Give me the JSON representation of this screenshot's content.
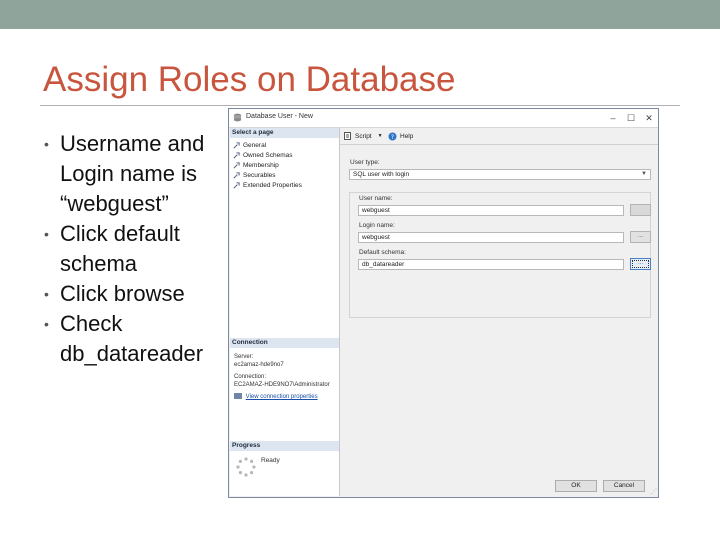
{
  "slide": {
    "title": "Assign Roles on Database",
    "bullets": [
      "Username and Login name is “webguest”",
      "Click default schema",
      "Click browse",
      "Check db_datareader"
    ],
    "accent_color": "#c8553d",
    "topbar_color": "#8fa49a"
  },
  "dialog": {
    "title": "Database User - New",
    "left_pane": {
      "select_page_header": "Select a page",
      "pages": [
        "General",
        "Owned Schemas",
        "Membership",
        "Securables",
        "Extended Properties"
      ],
      "connection_header": "Connection",
      "server_label": "Server:",
      "server_value": "ec2amaz-hde9no7",
      "connection_label": "Connection:",
      "connection_value": "EC2AMAZ-HDE9NO7\\Administrator",
      "view_connection_link": "View connection properties",
      "progress_header": "Progress",
      "progress_status": "Ready"
    },
    "toolbar": {
      "script_label": "Script",
      "help_label": "Help"
    },
    "form": {
      "user_type_label": "User type:",
      "user_type_value": "SQL user with login",
      "user_name_label": "User name:",
      "user_name_value": "webguest",
      "login_name_label": "Login name:",
      "login_name_value": "webguest",
      "default_schema_label": "Default schema:",
      "default_schema_value": "db_datareader",
      "browse_label": "..."
    },
    "buttons": {
      "ok": "OK",
      "cancel": "Cancel"
    }
  }
}
